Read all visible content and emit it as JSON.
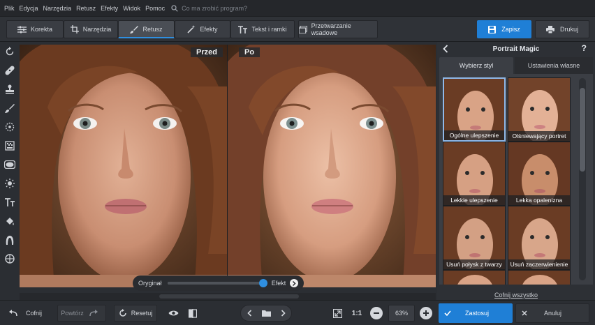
{
  "menu": {
    "items": [
      "Plik",
      "Edycja",
      "Narzędzia",
      "Retusz",
      "Efekty",
      "Widok",
      "Pomoc"
    ],
    "search_placeholder": "Co ma zrobić program?"
  },
  "toolbar": {
    "tabs": [
      "Korekta",
      "Narzędzia",
      "Retusz",
      "Efekty",
      "Tekst i ramki",
      "Przetwarzanie wsadowe"
    ],
    "active_tab": "Retusz",
    "save_label": "Zapisz",
    "print_label": "Drukuj"
  },
  "canvas": {
    "before_label": "Przed",
    "after_label": "Po"
  },
  "slider": {
    "left_label": "Oryginał",
    "right_label": "Efekt"
  },
  "panel": {
    "title": "Portrait Magic",
    "help": "?",
    "tab_styles": "Wybierz styl",
    "tab_custom": "Ustawienia własne",
    "presets": [
      "Ogólne ulepszenie",
      "Olśniewający portret",
      "Lekkie ulepszenie",
      "Lekka opalenizna",
      "Usuń połysk z twarzy",
      "Usuń zaczerwienienie"
    ],
    "undo_all": "Cofnij wszystko",
    "apply": "Zastosuj",
    "cancel": "Anuluj"
  },
  "bottom": {
    "undo": "Cofnij",
    "redo": "Powtórz",
    "reset": "Resetuj",
    "ratio": "1:1",
    "zoom": "63%"
  },
  "colors": {
    "accent": "#1f7fd6",
    "background": "#2b2e33"
  }
}
